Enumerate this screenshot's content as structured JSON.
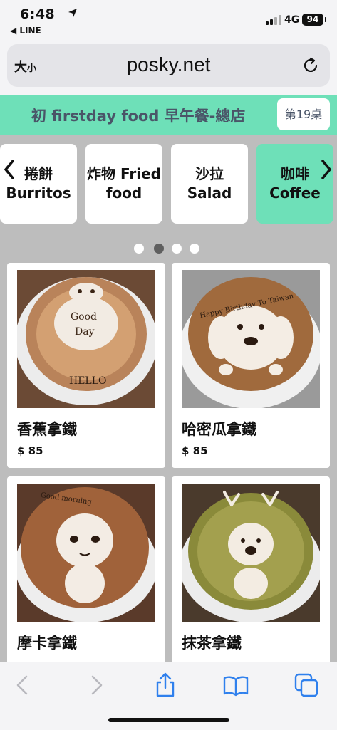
{
  "status": {
    "time": "6:48",
    "back_app": "◀ LINE",
    "network": "4G",
    "battery": "94"
  },
  "browser": {
    "text_size_big": "大",
    "text_size_small": "小",
    "domain": "posky.net"
  },
  "store": {
    "title": "初 firstday food 早午餐-總店",
    "table": "第19桌"
  },
  "categories": [
    {
      "line1": "捲餅",
      "line2": "Burritos",
      "active": false
    },
    {
      "line1": "炸物 Fried",
      "line2": "food",
      "active": false
    },
    {
      "line1": "沙拉",
      "line2": "Salad",
      "active": false
    },
    {
      "line1": "咖啡",
      "line2": "Coffee",
      "active": true
    }
  ],
  "carousel": {
    "pages": 4,
    "current": 2
  },
  "products": [
    {
      "name": "香蕉拿鐵",
      "price": "$ 85",
      "photo": "latte-art-cat-good-day-hello"
    },
    {
      "name": "哈密瓜拿鐵",
      "price": "$ 85",
      "photo": "latte-art-dog-happy-birthday"
    },
    {
      "name": "摩卡拿鐵",
      "price": "",
      "photo": "latte-art-girl-good-morning"
    },
    {
      "name": "抹茶拿鐵",
      "price": "",
      "photo": "latte-art-reindeer-matcha"
    }
  ],
  "latte_art_text": {
    "p1_line1": "Good",
    "p1_line2": "Day",
    "p1_bottom": "HELLO",
    "p2_top": "Happy Birthday To Taiwan",
    "p3_top": "Good morning"
  },
  "colors": {
    "accent": "#6ee0b8",
    "header_text": "#4a5568",
    "toolbar_icon": "#2f80ed"
  }
}
